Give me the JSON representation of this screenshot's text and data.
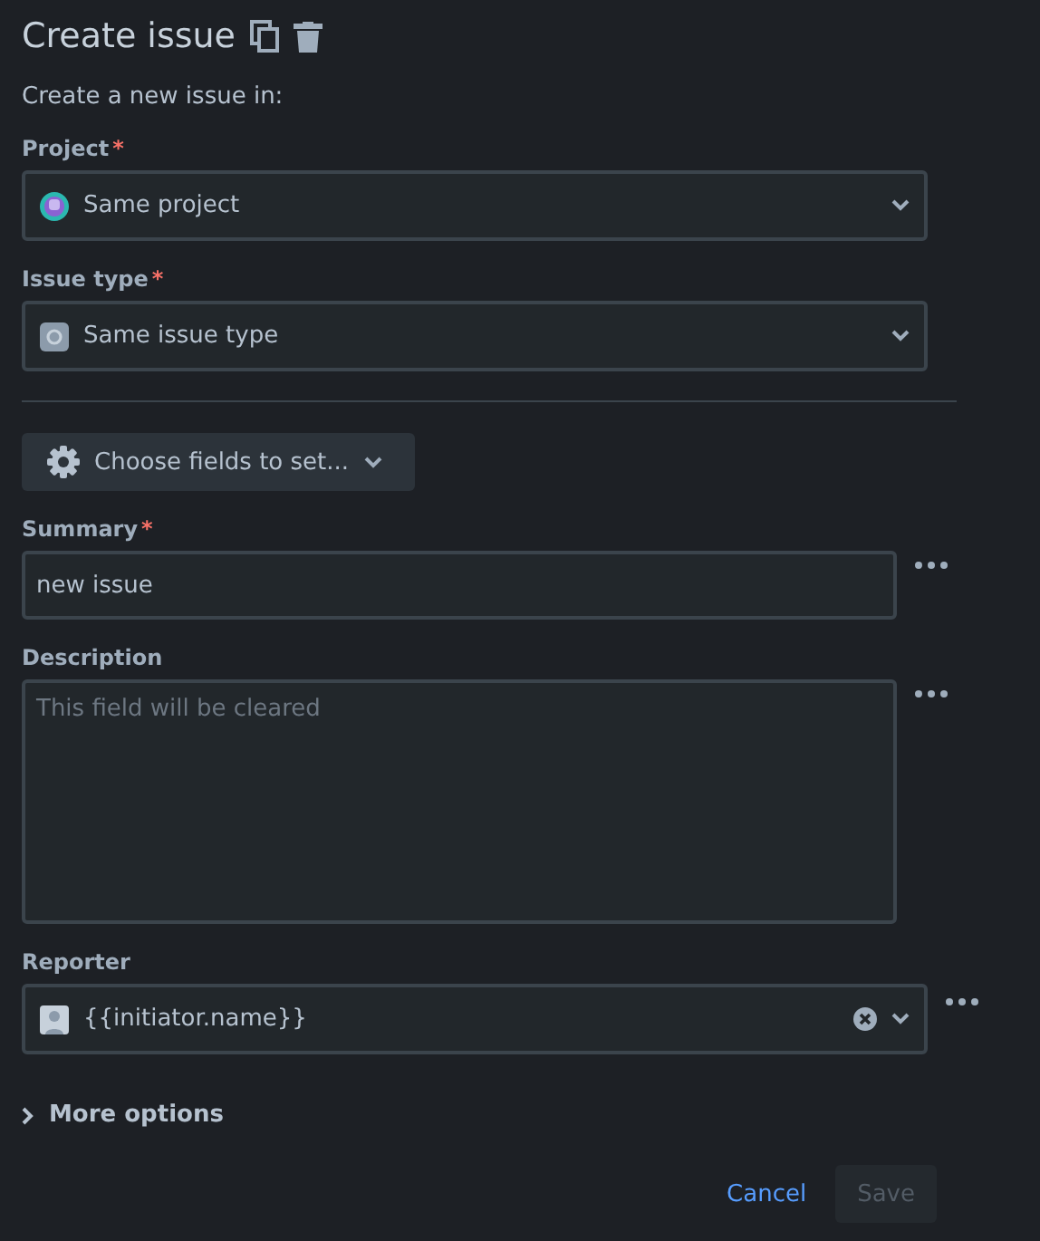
{
  "header": {
    "title": "Create issue"
  },
  "intro": "Create a new issue in:",
  "selects": [
    {
      "label": "Project",
      "marker": "*",
      "value": "Same project",
      "kind": "project"
    },
    {
      "label": "Issue type",
      "marker": "*",
      "value": "Same issue type",
      "kind": "type"
    }
  ],
  "choose_fields": {
    "label": "Choose fields to set..."
  },
  "fields": [
    {
      "kind": "input",
      "label": "Summary",
      "marker": "*",
      "value": "new issue"
    },
    {
      "kind": "textarea",
      "label": "Description",
      "placeholder": "This field will be cleared"
    },
    {
      "kind": "user",
      "label": "Reporter",
      "value": "{{initiator.name}}"
    }
  ],
  "more_options": {
    "label": "More options",
    "expanded": false
  },
  "footer": {
    "cancel": "Cancel",
    "save": {
      "label": "Save",
      "disabled": true
    }
  }
}
